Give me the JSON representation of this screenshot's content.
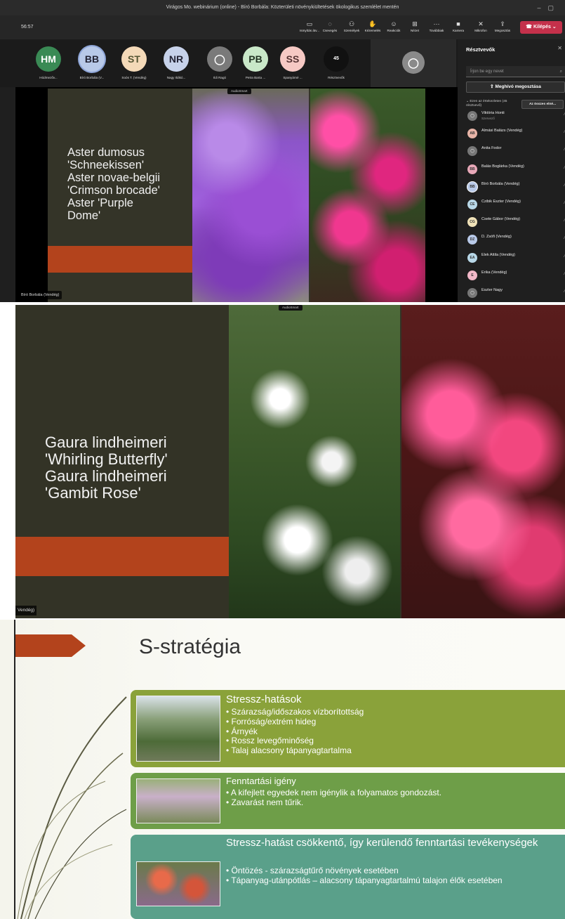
{
  "window": {
    "title": "Virágos Mo. webinárium (online) - Bíró Borbála: Közterületi növénykiültetések ökologikus szemlélet mentén"
  },
  "toolbar": {
    "timer": "56:57",
    "tools": [
      {
        "icon": "whiteboard-icon",
        "label": "Ismyítás átv..."
      },
      {
        "icon": "chat-icon",
        "label": "Csevegés"
      },
      {
        "icon": "people-icon",
        "label": "Személyek"
      },
      {
        "icon": "hand-icon",
        "label": "Kézemelés"
      },
      {
        "icon": "reaction-icon",
        "label": "Reakciók"
      },
      {
        "icon": "view-icon",
        "label": "Nézet"
      },
      {
        "icon": "more-icon",
        "label": "Továbbiak"
      },
      {
        "icon": "camera-icon",
        "label": "Kamera"
      },
      {
        "icon": "microphone-icon",
        "label": "Mikrofon"
      },
      {
        "icon": "share-icon",
        "label": "Megosztás"
      }
    ],
    "leave_label": "Kilépés"
  },
  "participants_strip": [
    {
      "initials": "HM",
      "name": "Hódmezőv...",
      "bg": "#3a8a55",
      "fg": "#fff"
    },
    {
      "initials": "BB",
      "name": "Bíró Borbála (V...",
      "bg": "#b8c9e8",
      "fg": "#223"
    },
    {
      "initials": "ST",
      "name": "Soós T. (Vendég)",
      "bg": "#f4d9b8",
      "fg": "#553"
    },
    {
      "initials": "NR",
      "name": "Nagy Ildikó...",
      "bg": "#c7d2ea",
      "fg": "#223"
    },
    {
      "initials": "",
      "name": "Ildi Ragó",
      "bg": "#7a7a7a",
      "fg": "#fff"
    },
    {
      "initials": "PB",
      "name": "Petra Barta ...",
      "bg": "#c9e8c8",
      "fg": "#232"
    },
    {
      "initials": "SS",
      "name": "Spanyárné ...",
      "bg": "#f6c9c4",
      "fg": "#533"
    },
    {
      "initials": "45",
      "name": "Résztvevők",
      "bg": "#111",
      "fg": "#fff"
    }
  ],
  "slide1": {
    "text": "Aster dumosus\n'Schneekissen'\nAster novae-belgii\n'Crimson brocade'\nAster 'Purple\nDome'",
    "watermark": "AudioSmart",
    "speaker": "Bíró Borbála (Vendég)"
  },
  "sidebar": {
    "title": "Résztvevők",
    "search_placeholder": "Írjon be egy nevet",
    "share_label": "Meghívó megosztása",
    "in_meeting": "Ezen az értekezleten (45 résztvevő)",
    "mute_all": "Az összes elné...",
    "people": [
      {
        "initials": "",
        "name": "Viktória Honti",
        "role": "Szervező",
        "bg": "#777"
      },
      {
        "initials": "AB",
        "name": "Almási Balázs (Vendég)",
        "role": "",
        "bg": "#e8b5a8"
      },
      {
        "initials": "",
        "name": "Anita Fodor",
        "role": "",
        "bg": "#777"
      },
      {
        "initials": "BB",
        "name": "Balás Boglárka (Vendég)",
        "role": "",
        "bg": "#e8a8b8"
      },
      {
        "initials": "BB",
        "name": "Bíró Borbála (Vendég)",
        "role": "",
        "bg": "#b8c9e8"
      },
      {
        "initials": "CE",
        "name": "Czibik Eszter (Vendég)",
        "role": "",
        "bg": "#b8d8e8"
      },
      {
        "initials": "CG",
        "name": "Csete Gábor (Vendég)",
        "role": "",
        "bg": "#f0e2b8"
      },
      {
        "initials": "DZ",
        "name": "D. Zsófi (Vendég)",
        "role": "",
        "bg": "#b8c9e8"
      },
      {
        "initials": "EA",
        "name": "Elek Attila (Vendég)",
        "role": "",
        "bg": "#b8d8e8"
      },
      {
        "initials": "E",
        "name": "Erika (Vendég)",
        "role": "",
        "bg": "#f2b8c8"
      },
      {
        "initials": "",
        "name": "Eszter Nagy",
        "role": "",
        "bg": "#777"
      }
    ]
  },
  "slide2": {
    "text": "Gaura lindheimeri\n'Whirling Butterfly'\nGaura lindheimeri\n'Gambit Rose'",
    "watermark": "AudioSmart",
    "speaker": "Vendég)"
  },
  "slide3": {
    "title": "S-stratégia",
    "boxes": [
      {
        "heading": "Stressz-hatások",
        "color": "#8aa23a",
        "items": [
          "Szárazság/időszakos vízborítottság",
          "Forróság/extrém hideg",
          "Árnyék",
          "Rossz levegőminőség",
          "Talaj alacsony tápanyagtartalma"
        ]
      },
      {
        "heading": "Fenntartási igény",
        "color": "#6e9e48",
        "items": [
          "A kifejlett egyedek nem igénylik a folyamatos gondozást.",
          "Zavarást nem tűrik."
        ]
      },
      {
        "heading": "Stressz-hatást csökkentő, így kerülendő fenntartási tevékenységek",
        "color": "#5aa08a",
        "items": [
          "Öntözés - szárazságtűrő növények esetében",
          "Tápanyag-utánpótlás – alacsony tápanyagtartalmú talajon élők esetében"
        ]
      }
    ]
  }
}
